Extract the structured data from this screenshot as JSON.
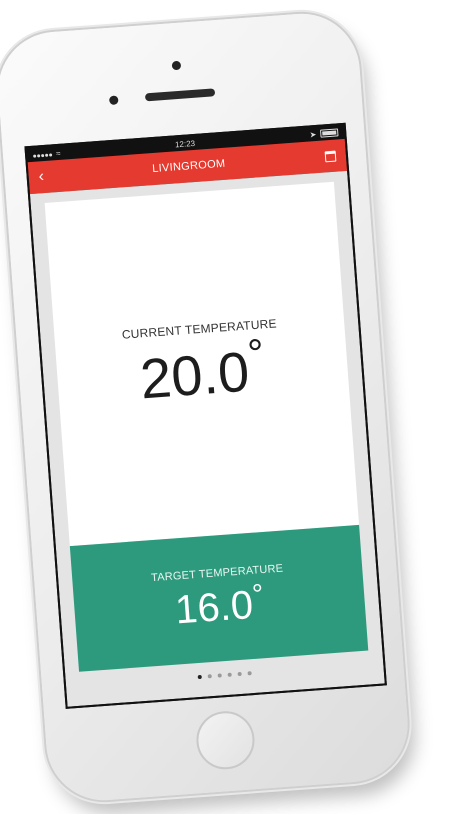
{
  "status": {
    "time": "12:23"
  },
  "nav": {
    "title": "LIVINGROOM",
    "back_icon": "chevron-left-icon",
    "calendar_icon": "calendar-icon"
  },
  "current": {
    "label": "CURRENT TEMPERATURE",
    "value": "20.0",
    "unit": "°"
  },
  "target": {
    "label": "TARGET TEMPERATURE",
    "value": "16.0",
    "unit": "°"
  },
  "pager": {
    "count": 6,
    "active_index": 0
  },
  "colors": {
    "nav": "#e53a2f",
    "target_card": "#2d9a7e",
    "background": "#e4e4e4"
  }
}
